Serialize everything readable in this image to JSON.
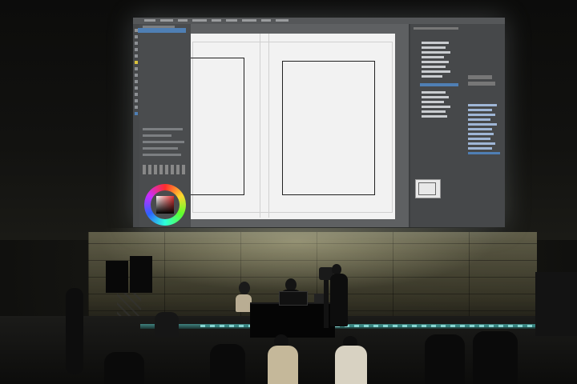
{
  "scene": {
    "description_elements": [
      "projection-screen",
      "stage",
      "speakers",
      "camera-operator",
      "presenters",
      "audience"
    ]
  },
  "colors": {
    "screen_ui_dark": "#3b3d3f",
    "canvas_white": "#f2f2f2",
    "stage_light": "#5fd6d1",
    "selection_blue": "#4f7fb4"
  }
}
